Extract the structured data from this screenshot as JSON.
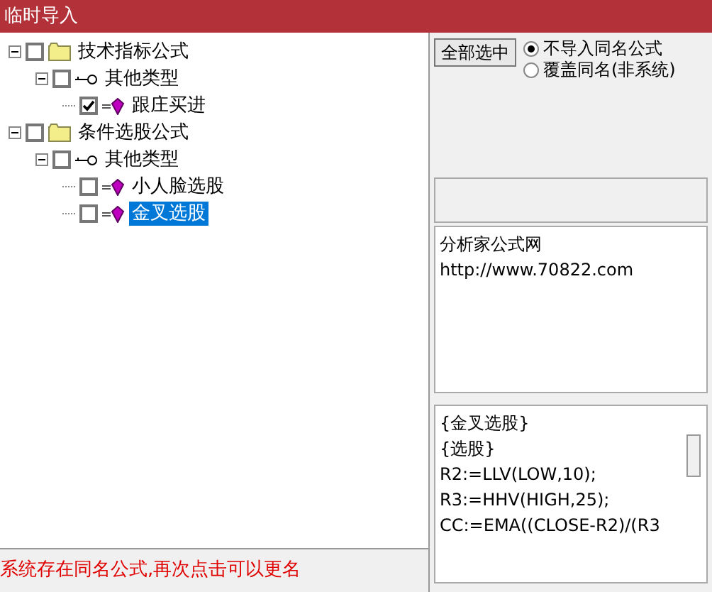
{
  "window": {
    "title": "临时导入"
  },
  "tree": [
    {
      "label": "技术指标公式",
      "kind": "folder",
      "expanded": true,
      "checked": false,
      "selected": false,
      "children": [
        {
          "label": "其他类型",
          "kind": "type",
          "expanded": true,
          "checked": false,
          "selected": false,
          "children": [
            {
              "label": "跟庄买进",
              "kind": "formula",
              "checked": true,
              "selected": false
            }
          ]
        }
      ]
    },
    {
      "label": "条件选股公式",
      "kind": "folder",
      "expanded": true,
      "checked": false,
      "selected": false,
      "children": [
        {
          "label": "其他类型",
          "kind": "type",
          "expanded": true,
          "checked": false,
          "selected": false,
          "children": [
            {
              "label": "小人脸选股",
              "kind": "formula",
              "checked": false,
              "selected": false
            },
            {
              "label": "金叉选股",
              "kind": "formula",
              "checked": false,
              "selected": true
            }
          ]
        }
      ]
    }
  ],
  "select_all_button": "全部选中",
  "options": [
    {
      "label": "不导入同名公式",
      "selected": true
    },
    {
      "label": "覆盖同名(非系统)",
      "selected": false
    }
  ],
  "info_box": [
    "分析家公式网",
    "http://www.70822.com"
  ],
  "code_box": [
    "{金叉选股}",
    "{选股}",
    "R2:=LLV(LOW,10);",
    "R3:=HHV(HIGH,25);",
    "CC:=EMA((CLOSE-R2)/(R3"
  ],
  "status": "系统存在同名公式,再次点击可以更名"
}
